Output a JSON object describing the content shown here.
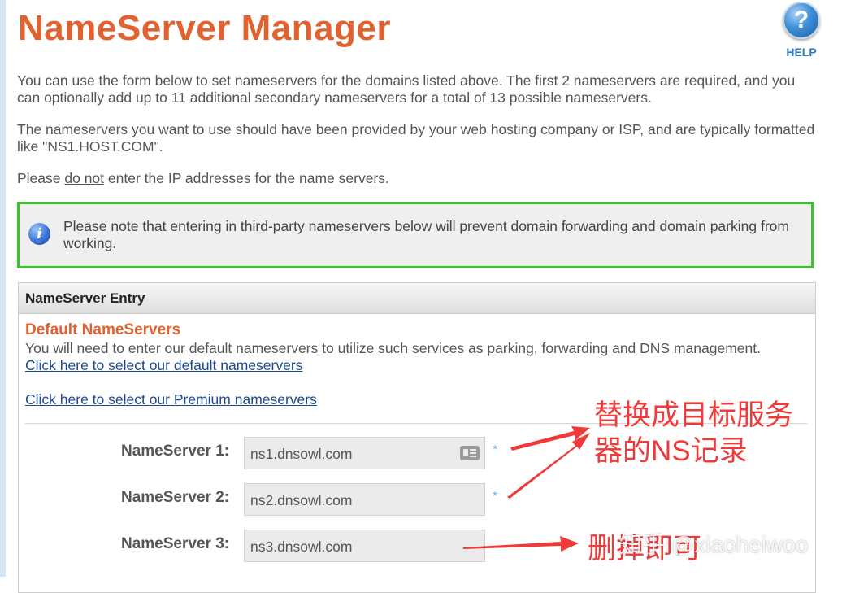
{
  "header": {
    "title": "NameServer Manager",
    "help_label": "HELP",
    "help_glyph": "?"
  },
  "intro": {
    "p1": "You can use the form below to set nameservers for the domains listed above. The first 2 nameservers are required, and you can optionally add up to 11 additional secondary nameservers for a total of 13 possible nameservers.",
    "p2": "The nameservers you want to use should have been provided by your web hosting company or ISP, and are typically formatted like \"NS1.HOST.COM\".",
    "p3_before": "Please ",
    "p3_underline": "do not",
    "p3_after": " enter the IP addresses for the name servers."
  },
  "notice": {
    "icon": "info-icon",
    "icon_glyph": "i",
    "text": "Please note that entering in third-party nameservers below will prevent domain forwarding and domain parking from working.",
    "border_color": "#3cc22e"
  },
  "panel": {
    "header": "NameServer Entry",
    "section_title": "Default NameServers",
    "section_desc": "You will need to enter our default nameservers to utilize such services as parking, forwarding and DNS management.",
    "link_default": "Click here to select our default nameservers",
    "link_premium": "Click here to select our Premium nameservers"
  },
  "nameservers": [
    {
      "label": "NameServer 1:",
      "value": "ns1.dnsowl.com",
      "required": "*",
      "icon": "contact-card-icon"
    },
    {
      "label": "NameServer 2:",
      "value": "ns2.dnsowl.com",
      "required": "*"
    },
    {
      "label": "NameServer 3:",
      "value": "ns3.dnsowl.com"
    }
  ],
  "annotations": {
    "main": "替换成目标服务器的NS记录",
    "delete": "删掉即可",
    "watermark": "知乎 @xiaoheiwoo"
  },
  "colors": {
    "title": "#e2622f",
    "link": "#1c4a8c",
    "annotation": "#f03a3a",
    "required": "#6fb0e6"
  }
}
